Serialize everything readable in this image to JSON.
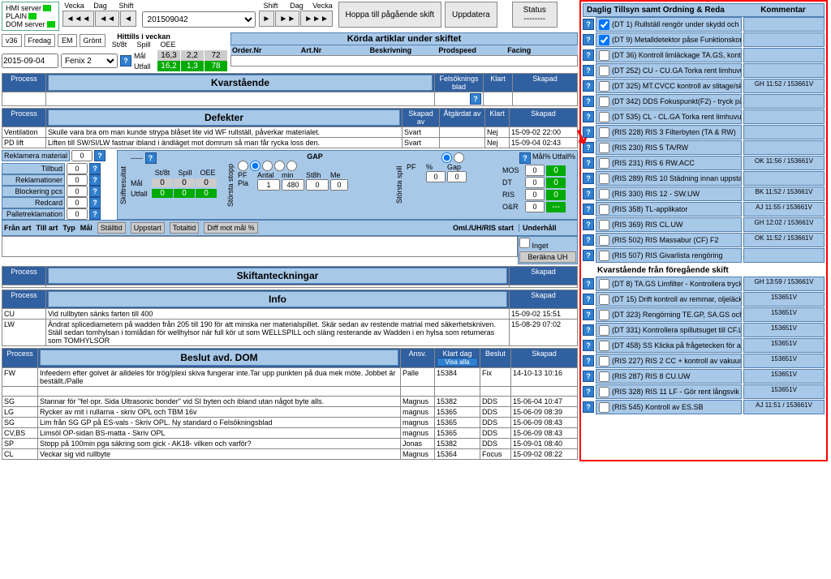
{
  "servers": {
    "hmi": "HMI server",
    "plain": "PLAIN",
    "dom": "DOM server"
  },
  "nav": {
    "vecka": "Vecka",
    "dag": "Dag",
    "shift": "Shift",
    "date": "201509042",
    "hoppa": "Hoppa till pågående skift",
    "uppdatera": "Uppdatera",
    "status": "Status",
    "status_val": "--------"
  },
  "week": {
    "v": "v36",
    "day": "Fredag",
    "shift": "EM",
    "color": "Grönt",
    "date": "2015-09-04",
    "line": "Fenix 2",
    "hittills": "Hittills i veckan",
    "stst": "St/8t",
    "spill": "Spill",
    "oee": "OEE",
    "mal_lbl": "Mål",
    "mal": [
      "16,3",
      "2,2",
      "72"
    ],
    "utfall_lbl": "Utfall",
    "utfall": [
      "16,2",
      "1,3",
      "78"
    ]
  },
  "korda": {
    "title": "Körda artiklar under skiftet",
    "cols": [
      "Order.Nr",
      "Art.Nr",
      "Beskrivning",
      "Prodspeed",
      "Facing"
    ]
  },
  "kvarst": {
    "title": "Kvarstående",
    "cols": [
      "Process",
      "",
      "Felsöknings blad",
      "Klart",
      "Skapad"
    ]
  },
  "defekter": {
    "title": "Defekter",
    "cols": [
      "Process",
      "",
      "Skapad av",
      "Åtgärdat av",
      "Klart",
      "Skapad"
    ],
    "rows": [
      {
        "proc": "Ventilation",
        "txt": "Skulle vara bra om man kunde strypa blåset lite vid WF rullställ, påverkar materialet.",
        "av": "Svart",
        "atg": "",
        "k": "Nej",
        "sk": "15-09-02 22:00"
      },
      {
        "proc": "PD lift",
        "txt": "Liften till SW/SI/LW fastnar ibland i ändläget mot domrum så man får rycka loss den.",
        "av": "Svart",
        "atg": "",
        "k": "Nej",
        "sk": "15-09-04 02:43"
      }
    ]
  },
  "counters": {
    "reklamera": "Reklamera material",
    "tillbud": "Tillbud",
    "reklamationer": "Reklamationer",
    "blockering": "Blockering pcs",
    "redcard": "Redcard",
    "pallet": "Palletreklamation",
    "stst": "St/8t",
    "spill": "Spill",
    "oee": "OEE",
    "mal": "Mål",
    "utfall": "Utfall",
    "storsta": "Största stopp",
    "gap": "GAP",
    "pf": "PF",
    "antal": "Antal",
    "min": "min",
    "st8h": "St8h",
    "me": "Me",
    "pla": "Pla",
    "pla_vals": [
      "1",
      "480",
      "0",
      "0"
    ],
    "pct": "%",
    "gap2": "Gap",
    "mos": "MOS",
    "dt": "DT",
    "ris": "RIS",
    "oar": "O&R",
    "mal_pct": "Mål%",
    "utfall_pct": "Utfall%",
    "vals": {
      "blockering": "0",
      "tillbud": "0",
      "reklamationer": "0",
      "redcard": "0",
      "pallet": "0",
      "reklamera": "0"
    },
    "side_vals": [
      "0",
      "0",
      "0",
      "0"
    ],
    "side_green": [
      "0",
      "0",
      "0",
      "---"
    ],
    "tri_mal": [
      "0",
      "0",
      "0"
    ],
    "tri_utfall": [
      "0",
      "0",
      "0"
    ]
  },
  "fran": {
    "fran": "Från art",
    "till": "Till art",
    "typ": "Typ",
    "mal": "Mål",
    "btns": [
      "Ställtid",
      "Uppstart",
      "Totaltid",
      "Diff mot mål %"
    ],
    "oml": "Oml./UH/RIS start",
    "underhall": "Underhåll",
    "inget": "Inget",
    "berakna": "Beräkna UH"
  },
  "skiftant": {
    "title": "Skiftanteckningar",
    "cols": [
      "Process",
      "",
      "Skapad"
    ]
  },
  "info": {
    "title": "Info",
    "cols": [
      "Process",
      "",
      "Skapad"
    ],
    "rows": [
      {
        "p": "CU",
        "t": "Vid rullbyten sänks farten till 400",
        "s": "15-09-02 15:51"
      },
      {
        "p": "LW",
        "t": "Ändrat splicediametern på wadden från 205 till 190 för att minska ner materialspillet. Skär sedan av restende matrial med säkerhetskniven. Ställ sedan tomhylsan i tomlådan för wellhylsor när full kör ut som WELLSPILL och släng resterande av Wadden i en hylsa som returneras som TOMHYLSOR",
        "s": "15-08-29 07:02"
      }
    ]
  },
  "beslut": {
    "title": "Beslut avd. DOM",
    "cols": [
      "Process",
      "",
      "Ansv.",
      "Klart dag",
      "Beslut",
      "Skapad"
    ],
    "visa": "Visa alla",
    "rows": [
      {
        "p": "FW",
        "t": "Infeedern efter golvet är alldeles för trög/plexi skiva fungerar inte.Tar upp punkten på dua mek möte. Jobbet är beställt./Palle",
        "a": "Palle",
        "k": "15384",
        "b": "Fix",
        "s": "14-10-13 10:16"
      },
      {
        "p": "",
        "t": "",
        "a": "",
        "k": "",
        "b": "",
        "s": ""
      },
      {
        "p": "SG",
        "t": "Stannar för \"fel opr. Sida Ultrasonic bonder\" vid SI byten och ibland utan något byte alls.",
        "a": "Magnus",
        "k": "15382",
        "b": "DDS",
        "s": "15-06-04 10:47"
      },
      {
        "p": "LG",
        "t": "Rycker av mit i rullarna - skriv OPL och TBM 16v",
        "a": "magnus",
        "k": "15365",
        "b": "DDS",
        "s": "15-06-09 08:39"
      },
      {
        "p": "SG",
        "t": "Lim från SG GP på ES-vals - Skriv OPL. Ny standard o Felsökningsblad",
        "a": "magnus",
        "k": "15365",
        "b": "DDS",
        "s": "15-06-09 08:43"
      },
      {
        "p": "CV,BS",
        "t": "Limsöl OP-sidan BS-matta - Skriv OPL",
        "a": "magnus",
        "k": "15365",
        "b": "DDS",
        "s": "15-06-09 08:43"
      },
      {
        "p": "SP",
        "t": "Stopp på 100min pga säkring som gick - AK18- vilken och varför?",
        "a": "Jonas",
        "k": "15382",
        "b": "DDS",
        "s": "15-09-01 08:40"
      },
      {
        "p": "CL",
        "t": "Veckar sig vid rullbyte",
        "a": "Magnus",
        "k": "15364",
        "b": "Focus",
        "s": "15-09-02 08:22"
      }
    ]
  },
  "tillsyn": {
    "title": "Daglig Tillsyn samt Ordning & Reda",
    "kommentar": "Kommentar",
    "items": [
      {
        "chk": true,
        "t": "(DT 1) Rullställ rengör under skydd och",
        "c": ""
      },
      {
        "chk": true,
        "t": "(DT 9) Metalldetektor påse Funktionskontroll",
        "c": ""
      },
      {
        "chk": false,
        "t": "(DT 36) Kontroll limläckage TA.GS, kontrollera att",
        "c": ""
      },
      {
        "chk": false,
        "t": "(DT 252) CU - CU.GA Torka rent limhuvud +",
        "c": ""
      },
      {
        "chk": false,
        "t": "(DT 325) MT.CVCC kontroll av slitage/skador",
        "c": "GH 11:52 / 153661V"
      },
      {
        "chk": false,
        "t": "(DT 342) DDS Fokuspunkt(F2) - tryck på",
        "c": ""
      },
      {
        "chk": false,
        "t": "(DT 535) CL - CL.GA Torka rent limhuvud +",
        "c": ""
      },
      {
        "chk": false,
        "t": "(RIS 228) RIS 3 Filterbyten (TA & RW)",
        "c": ""
      },
      {
        "chk": false,
        "t": "(RIS 230) RIS 5 TA/RW",
        "c": ""
      },
      {
        "chk": false,
        "t": "(RIS 231) RIS 6 RW.ACC",
        "c": "OK 11:56 / 153661V"
      },
      {
        "chk": false,
        "t": "(RIS 289) RIS 10 Städning innan uppstart",
        "c": ""
      },
      {
        "chk": false,
        "t": "(RIS 330) RIS 12 - SW.UW",
        "c": "BK 11:52 / 153661V"
      },
      {
        "chk": false,
        "t": "(RIS 358) TL-applikator",
        "c": "AJ 11:55 / 153661V"
      },
      {
        "chk": false,
        "t": "(RIS 369) RIS CL.UW",
        "c": "GH 12:02 / 153661V"
      },
      {
        "chk": false,
        "t": "(RIS 502) RIS Massabur (CF) F2",
        "c": "OK 11:52 / 153661V"
      },
      {
        "chk": false,
        "t": "(RIS 507) RIS Givarlista rengöring",
        "c": ""
      }
    ],
    "prev_title": "Kvarstående från föregående skift",
    "prev": [
      {
        "t": "(DT 8) TA.GS Limfilter - Kontrollera tryck. Vid",
        "c": "GH 13:59 / 153661V"
      },
      {
        "t": "(DT 15) Drift kontroll av remmar, oljeläckage",
        "c": "153651V"
      },
      {
        "t": "(DT 323) Rengörning TE.GP, SA.GS och BS.GS +",
        "c": "153651V"
      },
      {
        "t": "(DT 331) Kontrollera spillutsuget till CF.LO (Modu",
        "c": "153651V"
      },
      {
        "t": "(DT 458) SS Klicka på frågetecken för att visa",
        "c": "153651V"
      },
      {
        "t": "(RIS 227) RIS 2 CC + kontroll av vakuum",
        "c": "153651V"
      },
      {
        "t": "(RIS 287) RIS 8 CU.UW",
        "c": "153651V"
      },
      {
        "t": "(RIS 328) RIS 11 LF - Gör rent långsvik från",
        "c": "153651V"
      },
      {
        "t": "(RIS 545) Kontroll av ES.SB",
        "c": "AJ 11:51 / 153661V"
      }
    ]
  }
}
